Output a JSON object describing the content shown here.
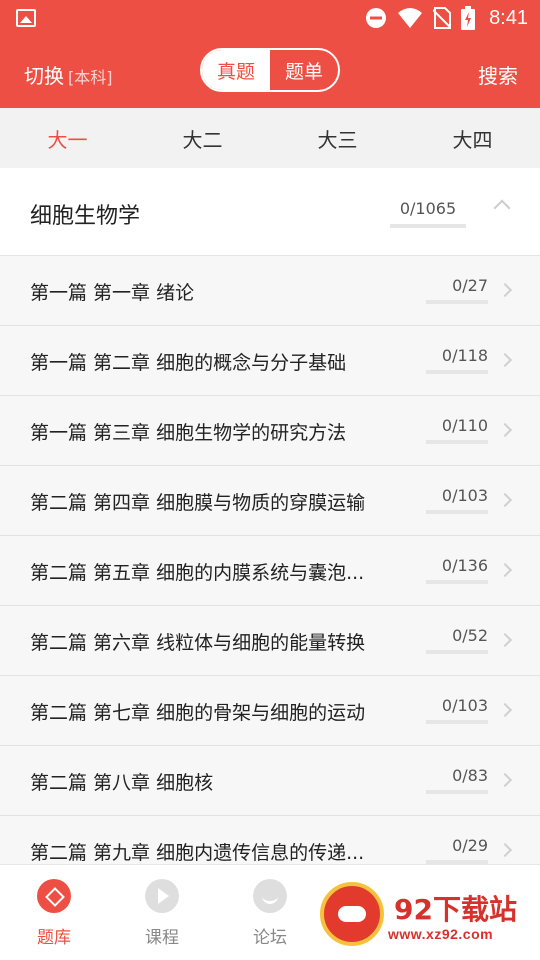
{
  "status_bar": {
    "time": "8:41",
    "icons": [
      "gallery-icon",
      "do-not-disturb-icon",
      "wifi-icon",
      "no-sim-icon",
      "battery-charging-icon"
    ]
  },
  "header": {
    "switch_label": "切换",
    "level_label": "[本科]",
    "segments": [
      {
        "label": "真题",
        "active": true
      },
      {
        "label": "题单",
        "active": false
      }
    ],
    "search_label": "搜索"
  },
  "year_tabs": [
    {
      "label": "大一",
      "active": true
    },
    {
      "label": "大二",
      "active": false
    },
    {
      "label": "大三",
      "active": false
    },
    {
      "label": "大四",
      "active": false
    }
  ],
  "subject": {
    "title": "细胞生物学",
    "progress": "0/1065",
    "expanded": true
  },
  "chapters": [
    {
      "title": "第一篇 第一章 绪论",
      "progress": "0/27"
    },
    {
      "title": "第一篇 第二章 细胞的概念与分子基础",
      "progress": "0/118"
    },
    {
      "title": "第一篇 第三章 细胞生物学的研究方法",
      "progress": "0/110"
    },
    {
      "title": "第二篇 第四章 细胞膜与物质的穿膜运输",
      "progress": "0/103"
    },
    {
      "title": "第二篇 第五章 细胞的内膜系统与囊泡...",
      "progress": "0/136"
    },
    {
      "title": "第二篇 第六章 线粒体与细胞的能量转换",
      "progress": "0/52"
    },
    {
      "title": "第二篇 第七章 细胞的骨架与细胞的运动",
      "progress": "0/103"
    },
    {
      "title": "第二篇 第八章 细胞核",
      "progress": "0/83"
    },
    {
      "title": "第二篇 第九章 细胞内遗传信息的传递...",
      "progress": "0/29"
    }
  ],
  "bottom_nav": [
    {
      "label": "题库",
      "icon": "question-bank-icon",
      "active": true
    },
    {
      "label": "课程",
      "icon": "play-icon",
      "active": false
    },
    {
      "label": "论坛",
      "icon": "forum-icon",
      "active": false
    }
  ],
  "watermark": {
    "title": "92下载站",
    "url": "www.xz92.com"
  },
  "colors": {
    "accent": "#ee4f45",
    "inactive": "#888888"
  }
}
